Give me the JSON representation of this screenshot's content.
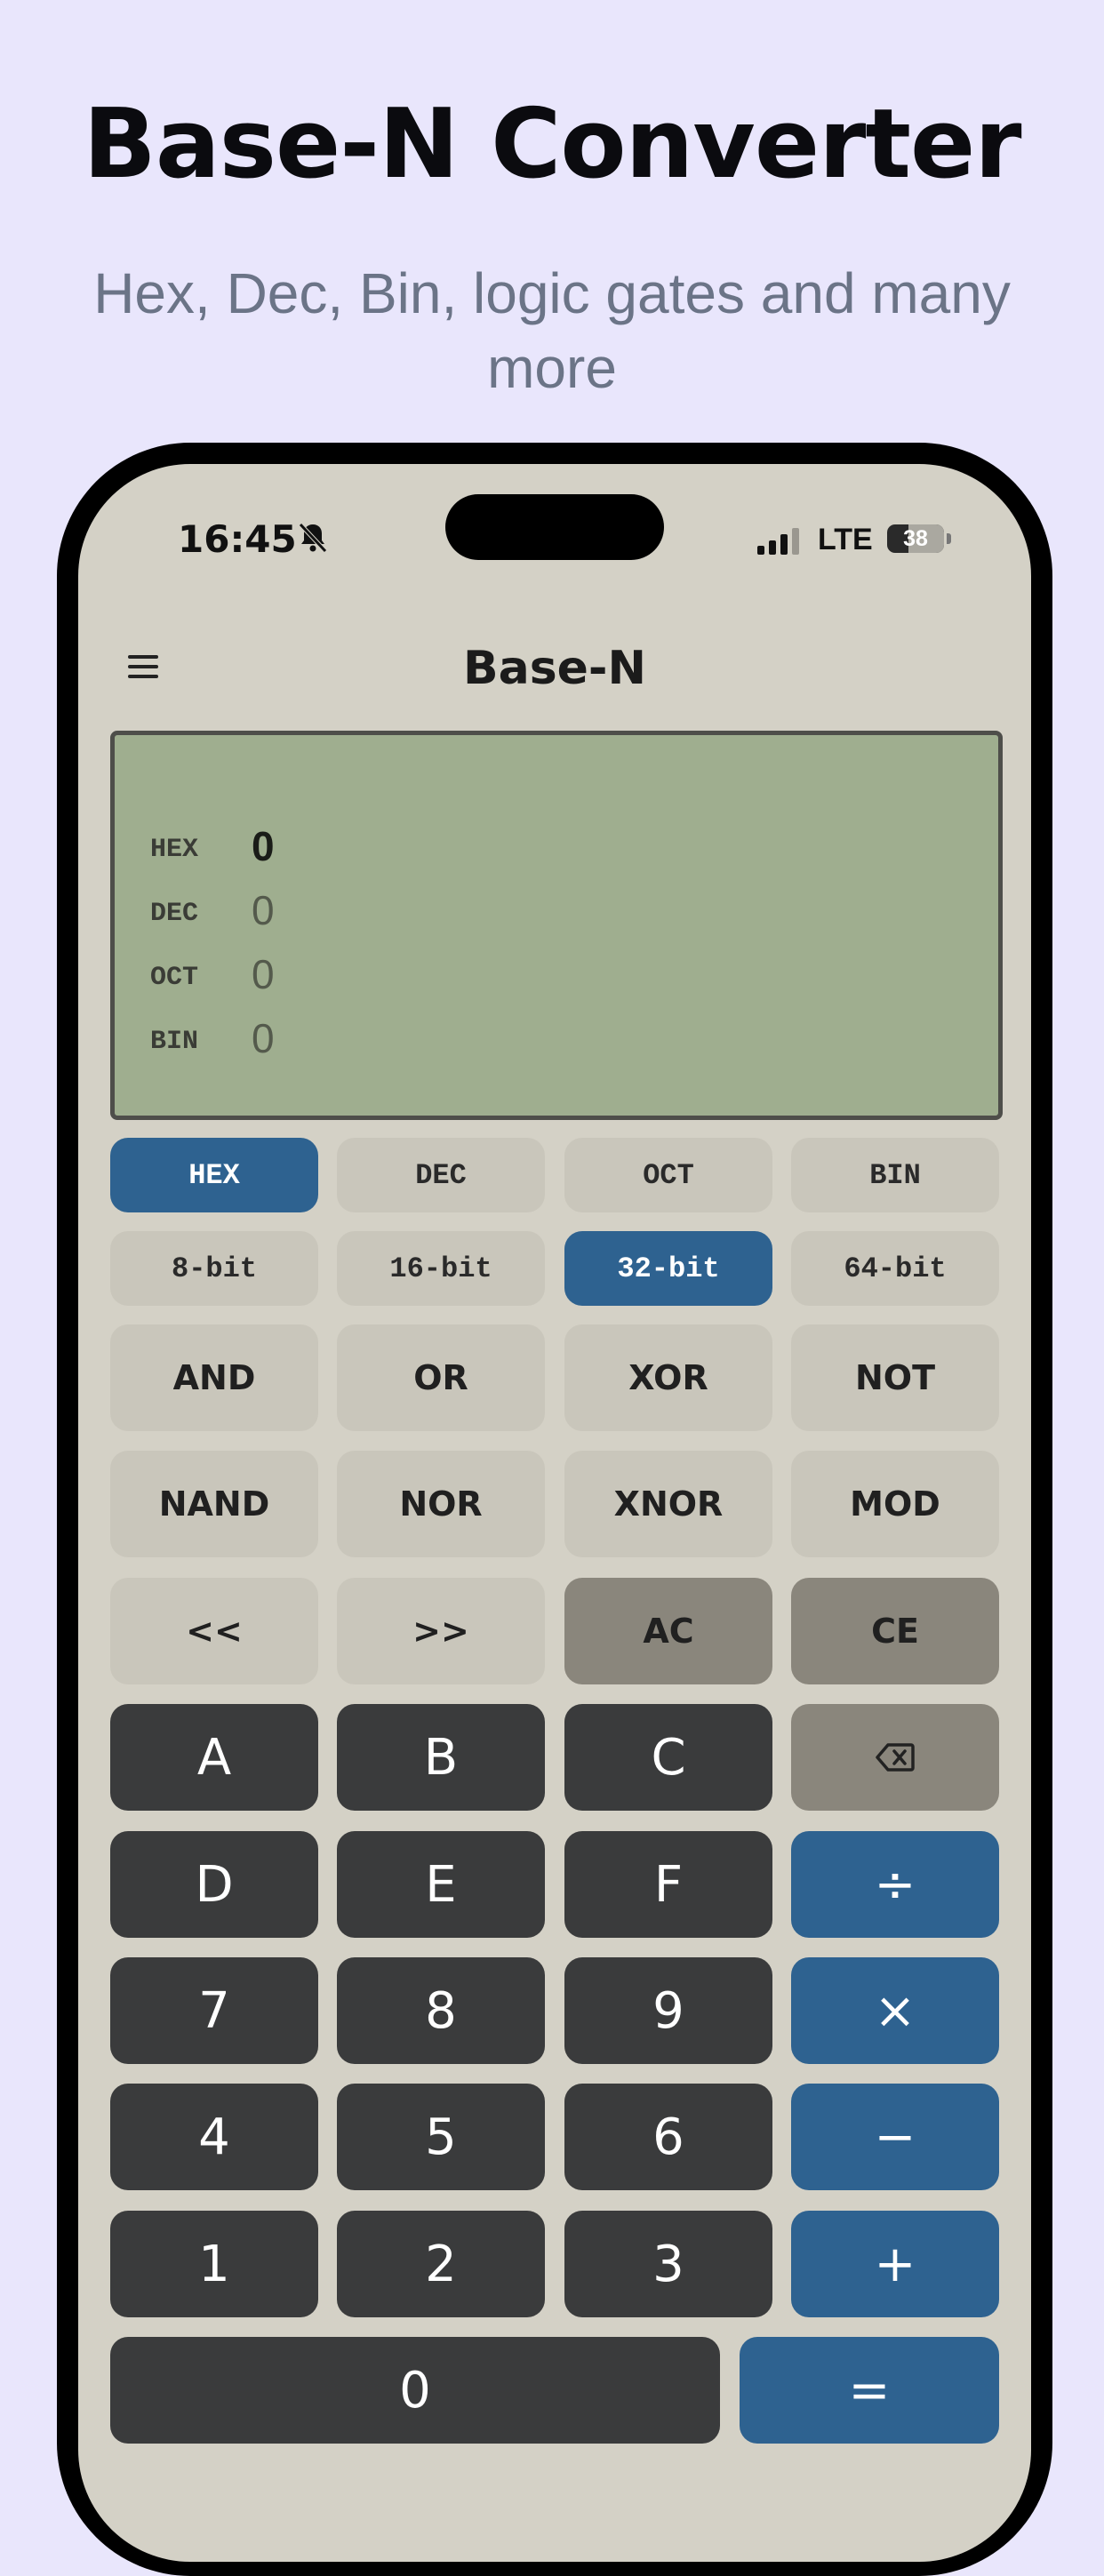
{
  "promo": {
    "title": "Base-N Converter",
    "subtitle": "Hex, Dec, Bin, logic gates and many more"
  },
  "status_bar": {
    "time": "16:45",
    "network": "LTE",
    "battery": "38",
    "icons": [
      "bell-slash-icon",
      "signal-icon",
      "battery-icon"
    ]
  },
  "app": {
    "title": "Base-N",
    "menu_icon": "hamburger-menu-icon"
  },
  "display": {
    "rows": [
      {
        "label": "HEX",
        "value": "0",
        "active": true
      },
      {
        "label": "DEC",
        "value": "0",
        "active": false
      },
      {
        "label": "OCT",
        "value": "0",
        "active": false
      },
      {
        "label": "BIN",
        "value": "0",
        "active": false
      }
    ]
  },
  "colors": {
    "accent_blue": "#2e6290",
    "display_green": "#9fae8f",
    "key_dark": "#3a3b3c",
    "key_gray": "#8a867c",
    "background": "#e9e6fc"
  },
  "base_buttons": [
    "HEX",
    "DEC",
    "OCT",
    "BIN"
  ],
  "base_selected": "HEX",
  "bit_buttons": [
    "8-bit",
    "16-bit",
    "32-bit",
    "64-bit"
  ],
  "bit_selected": "32-bit",
  "logic_row1": [
    "AND",
    "OR",
    "XOR",
    "NOT"
  ],
  "logic_row2": [
    "NAND",
    "NOR",
    "XNOR",
    "MOD"
  ],
  "shift_row": [
    "<<",
    ">>",
    "AC",
    "CE"
  ],
  "keypad": {
    "row1": [
      "A",
      "B",
      "C"
    ],
    "backspace_icon": "backspace-icon",
    "row2": [
      "D",
      "E",
      "F",
      "÷"
    ],
    "row3": [
      "7",
      "8",
      "9",
      "×"
    ],
    "row4": [
      "4",
      "5",
      "6",
      "−"
    ],
    "row5": [
      "1",
      "2",
      "3",
      "+"
    ],
    "row6": [
      "0",
      "="
    ]
  }
}
